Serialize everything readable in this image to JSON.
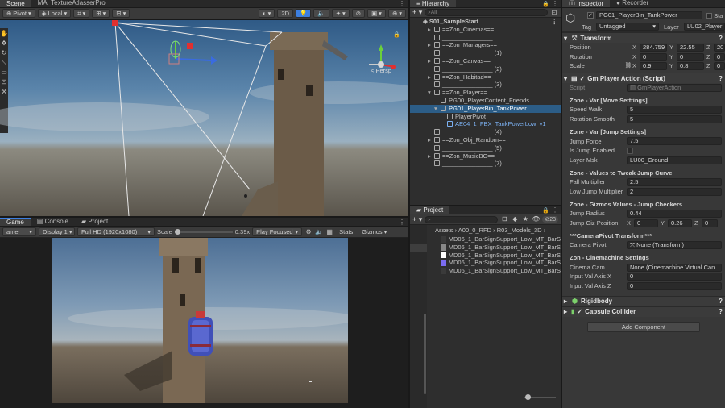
{
  "scene_panel": {
    "tabs": [
      "Scene",
      "MA_TextureAtlasserPro"
    ],
    "toolbar": {
      "pivot": "Pivot",
      "local": "Local",
      "mode_2d": "2D"
    },
    "persp_label": "< Persp"
  },
  "game_panel": {
    "tabs": [
      "Game",
      "Console",
      "Project"
    ],
    "toolbar": {
      "game_dropdown": "ame",
      "display": "Display 1",
      "resolution": "Full HD (1920x1080)",
      "scale_label": "Scale",
      "scale_value": "0.39x",
      "play_focused": "Play Focused",
      "stats": "Stats",
      "gizmos": "Gizmos"
    }
  },
  "hierarchy": {
    "tab": "Hierarchy",
    "search_placeholder": "All",
    "scene_name": "S01_SampleStart",
    "items": [
      {
        "label": "==Zon_Cinemas==",
        "indent": 1,
        "selected": false,
        "prefab": false
      },
      {
        "label": "_______________",
        "indent": 1,
        "selected": false,
        "prefab": false
      },
      {
        "label": "==Zon_Managers==",
        "indent": 1,
        "selected": false,
        "prefab": false
      },
      {
        "label": "_______________ (1)",
        "indent": 1,
        "selected": false,
        "prefab": false
      },
      {
        "label": "==Zon_Canvas==",
        "indent": 1,
        "selected": false,
        "prefab": false
      },
      {
        "label": "_______________ (2)",
        "indent": 1,
        "selected": false,
        "prefab": false
      },
      {
        "label": "==Zon_Habitad==",
        "indent": 1,
        "selected": false,
        "prefab": false
      },
      {
        "label": "_______________ (3)",
        "indent": 1,
        "selected": false,
        "prefab": false
      },
      {
        "label": "==Zon_Player==",
        "indent": 1,
        "selected": false,
        "prefab": false
      },
      {
        "label": "PG00_PlayerContent_Friends",
        "indent": 2,
        "selected": false,
        "prefab": false
      },
      {
        "label": "PG01_PlayerBin_TankPower",
        "indent": 2,
        "selected": true,
        "prefab": false
      },
      {
        "label": "PlayerPivot",
        "indent": 3,
        "selected": false,
        "prefab": false
      },
      {
        "label": "AE04_1_FBX_TankPowerLow_v1",
        "indent": 3,
        "selected": false,
        "prefab": true
      },
      {
        "label": "_______________ (4)",
        "indent": 1,
        "selected": false,
        "prefab": false
      },
      {
        "label": "==Zon_Obj_Random==",
        "indent": 1,
        "selected": false,
        "prefab": false
      },
      {
        "label": "_______________ (5)",
        "indent": 1,
        "selected": false,
        "prefab": false
      },
      {
        "label": "==Zon_MusicBG==",
        "indent": 1,
        "selected": false,
        "prefab": false
      },
      {
        "label": "_______________ (7)",
        "indent": 1,
        "selected": false,
        "prefab": false
      }
    ]
  },
  "project": {
    "tab": "Project",
    "count": "23",
    "breadcrumb": [
      "Assets",
      "A00_0_RFD",
      "R03_Models_3D"
    ],
    "files": [
      "MD06_1_BarSignSupport_Low_MT_BarS",
      "MD06_1_BarSignSupport_Low_MT_BarS",
      "MD06_1_BarSignSupport_Low_MT_BarS",
      "MD06_1_BarSignSupport_Low_MT_BarS",
      "MD06_1_BarSignSupport_Low_MT_BarS"
    ],
    "file_swatches": [
      "#3a3a3a",
      "#888888",
      "#ffffff",
      "#7b6cf0",
      "#3a3a3a"
    ]
  },
  "inspector": {
    "tabs": [
      "Inspector",
      "Recorder"
    ],
    "object_name": "PG01_PlayerBin_TankPower",
    "static_label": "Sta",
    "tag_label": "Tag",
    "tag_value": "Untagged",
    "layer_label": "Layer",
    "layer_value": "LU02_Player",
    "transform": {
      "title": "Transform",
      "position": {
        "label": "Position",
        "x": "284.759",
        "y": "22.55",
        "z": "20"
      },
      "rotation": {
        "label": "Rotation",
        "x": "0",
        "y": "0",
        "z": "0"
      },
      "scale": {
        "label": "Scale",
        "x": "0.9",
        "y": "0.8",
        "z": "0"
      }
    },
    "script_component": {
      "title": "Gm Player Action (Script)",
      "script_label": "Script",
      "script_value": "GmPlayerAction"
    },
    "sections": [
      {
        "header": "Zone - Var [Move Setttings]",
        "fields": [
          {
            "label": "Speed Walk",
            "value": "5"
          },
          {
            "label": "Rotation Smooth",
            "value": "5"
          }
        ]
      },
      {
        "header": "Zone - Var [Jump Settings]",
        "fields": [
          {
            "label": "Jump Force",
            "value": "7.5"
          },
          {
            "label": "Is Jump Enabled",
            "value": ""
          },
          {
            "label": "Layer Msk",
            "value": "LU00_Ground"
          }
        ]
      },
      {
        "header": "Zone - Values to Tweak Jump Curve",
        "fields": [
          {
            "label": "Fall Multiplier",
            "value": "2.5"
          },
          {
            "label": "Low Jump Multiplier",
            "value": "2"
          }
        ]
      },
      {
        "header": "Zone - Gizmos Values - Jump Checkers",
        "fields": [
          {
            "label": "Jump Radius",
            "value": "0.44"
          }
        ]
      }
    ],
    "jump_giz_position": {
      "label": "Jump Giz Position",
      "x": "0",
      "y": "0.26",
      "z": "0"
    },
    "camera_section": {
      "header": "***CameraPivot Transform***",
      "label": "Camera Pivot",
      "value": "None (Transform)"
    },
    "cinemachine_section": {
      "header": "Zon - Cinemachine Settings",
      "fields": [
        {
          "label": "Cinema Cam",
          "value": "None (Cinemachine Virtual Can"
        },
        {
          "label": "Input Val Axis X",
          "value": "0"
        },
        {
          "label": "Input Val Axis Z",
          "value": "0"
        }
      ]
    },
    "rigidbody": "Rigidbody",
    "capsule_collider": "Capsule Collider",
    "add_component": "Add Component"
  },
  "colors": {
    "accent": "#3d7fe0",
    "selection": "#2c5d87",
    "prefab_text": "#7cb1f2"
  }
}
